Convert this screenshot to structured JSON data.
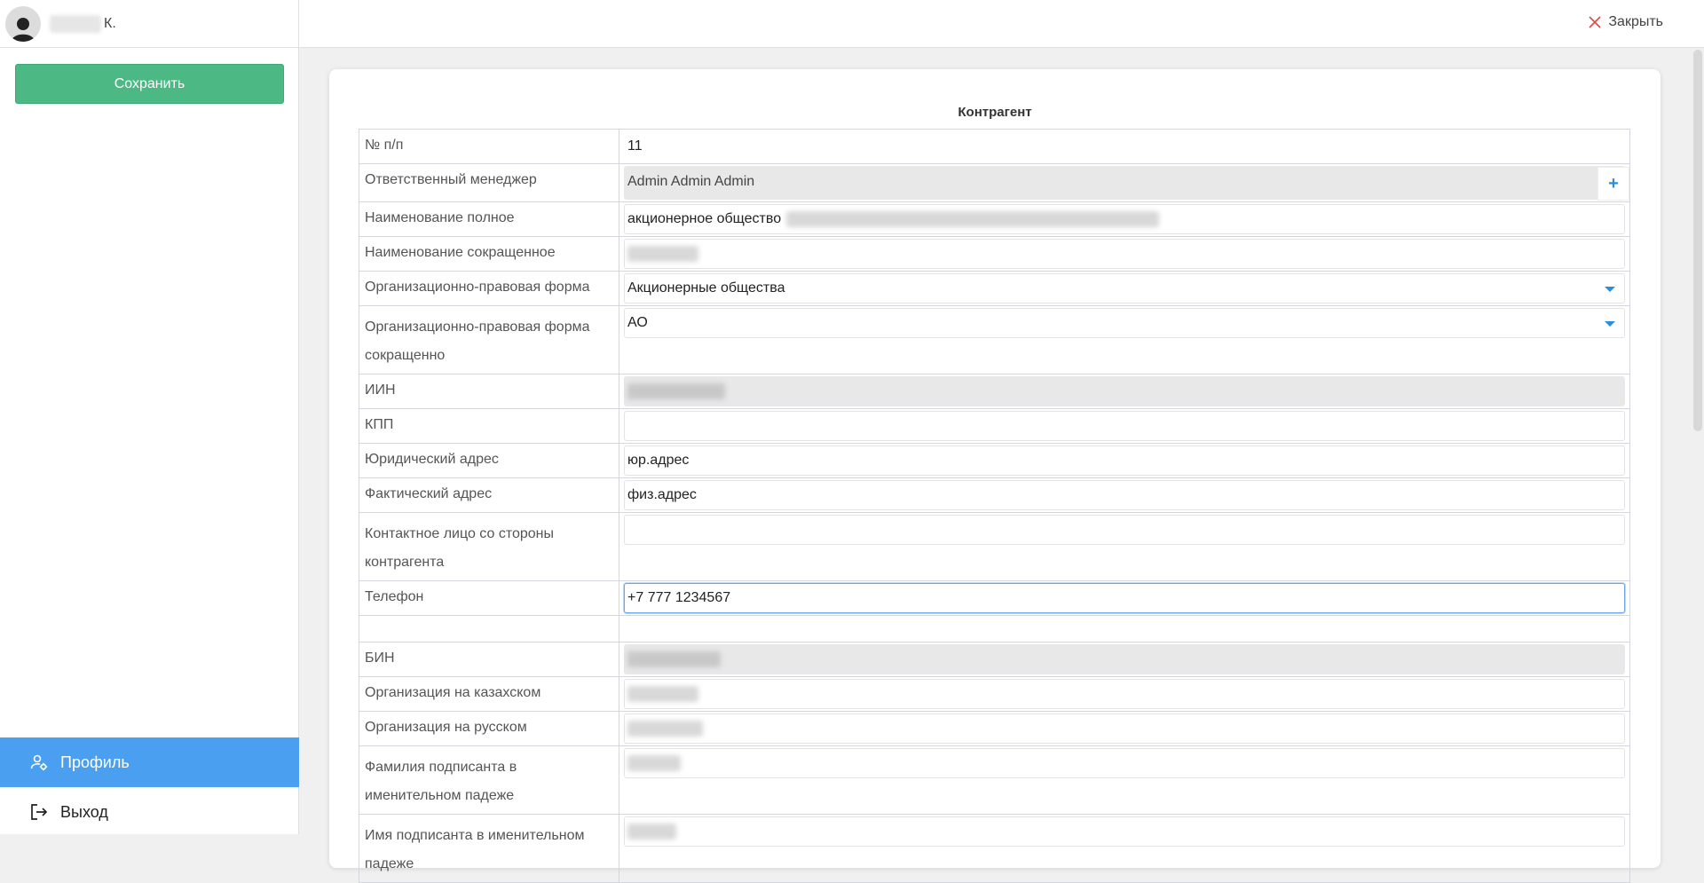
{
  "user": {
    "initial": "К."
  },
  "sidebar": {
    "save_label": "Сохранить",
    "nav": [
      {
        "label": "Профиль",
        "icon": "user-gear-icon",
        "active": true
      },
      {
        "label": "Выход",
        "icon": "logout-icon",
        "active": false
      }
    ]
  },
  "topbar": {
    "close_label": "Закрыть"
  },
  "form": {
    "title": "Контрагент",
    "rows": {
      "num": {
        "label": "№ п/п",
        "value": "11"
      },
      "manager": {
        "label": "Ответственный менеджер",
        "value": "Admin Admin Admin",
        "plus": "+"
      },
      "full_name": {
        "label": "Наименование полное",
        "value": "акционерное общество"
      },
      "short_name": {
        "label": "Наименование сокращенное",
        "value": ""
      },
      "org_form": {
        "label": "Организационно-правовая форма",
        "value": "Акционерные общества"
      },
      "org_form_short": {
        "label": "Организационно-правовая форма сокращенно",
        "value": "АО"
      },
      "iin": {
        "label": "ИИН",
        "value": ""
      },
      "kpp": {
        "label": "КПП",
        "value": ""
      },
      "legal_addr": {
        "label": "Юридический адрес",
        "value": "юр.адрес"
      },
      "fact_addr": {
        "label": "Фактический адрес",
        "value": "физ.адрес"
      },
      "contact": {
        "label": "Контактное лицо со стороны контрагента",
        "value": ""
      },
      "phone": {
        "label": "Телефон",
        "value": "+7 777 1234567"
      },
      "bin": {
        "label": "БИН",
        "value": ""
      },
      "org_kz": {
        "label": "Организация на казахском",
        "value": ""
      },
      "org_ru": {
        "label": "Организация на русском",
        "value": ""
      },
      "signer_last": {
        "label": "Фамилия подписанта в именительном падеже",
        "value": ""
      },
      "signer_first": {
        "label": "Имя подписанта в именительном падеже",
        "value": ""
      }
    }
  },
  "colors": {
    "save": "#4cb985",
    "active_nav": "#4a9ff0",
    "accent": "#2a8ee0",
    "close_x": "#e04848"
  }
}
